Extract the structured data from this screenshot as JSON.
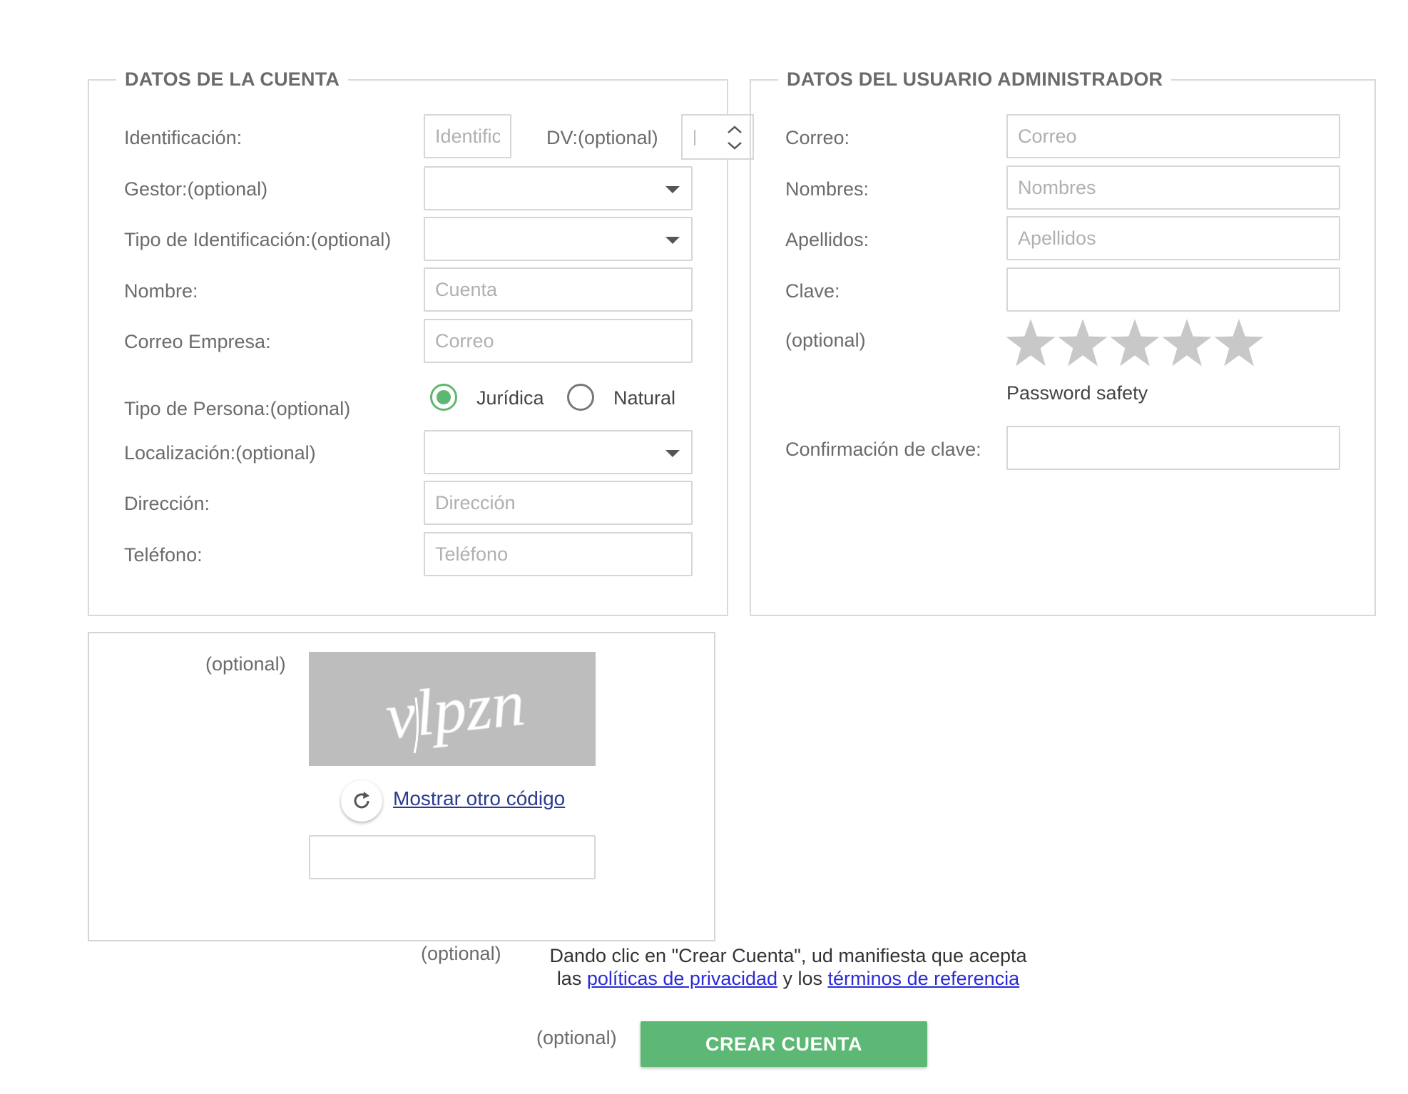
{
  "account": {
    "legend": "DATOS DE LA CUENTA",
    "identificacion": {
      "label": "Identificación:",
      "placeholder": "Identificación"
    },
    "dv": {
      "label": "DV:(optional)",
      "value": ""
    },
    "gestor": {
      "label": "Gestor:(optional)",
      "value": ""
    },
    "tipo_identificacion": {
      "label": "Tipo de Identificación:(optional)",
      "value": ""
    },
    "nombre": {
      "label": "Nombre:",
      "placeholder": "Cuenta"
    },
    "correo_empresa": {
      "label": "Correo Empresa:",
      "placeholder": "Correo"
    },
    "tipo_persona": {
      "label": "Tipo de Persona:(optional)",
      "options": [
        "Jurídica",
        "Natural"
      ],
      "selected": "Jurídica"
    },
    "localizacion": {
      "label": "Localización:(optional)",
      "value": ""
    },
    "direccion": {
      "label": "Dirección:",
      "placeholder": "Dirección"
    },
    "telefono": {
      "label": "Teléfono:",
      "placeholder": "Teléfono"
    }
  },
  "admin": {
    "legend": "DATOS DEL USUARIO ADMINISTRADOR",
    "correo": {
      "label": "Correo:",
      "placeholder": "Correo"
    },
    "nombres": {
      "label": "Nombres:",
      "placeholder": "Nombres"
    },
    "apellidos": {
      "label": "Apellidos:",
      "placeholder": "Apellidos"
    },
    "clave": {
      "label": "Clave:",
      "value": ""
    },
    "strength": {
      "label": "(optional)",
      "caption": "Password safety",
      "rating": 0,
      "max": 5
    },
    "confirmacion": {
      "label": "Confirmación de clave:",
      "value": ""
    }
  },
  "captcha": {
    "label": "(optional)",
    "image_text": "vlpzn",
    "refresh_link": "Mostrar otro código",
    "input_value": ""
  },
  "terms": {
    "label": "(optional)",
    "line1": "Dando clic en \"Crear Cuenta\", ud manifiesta que acepta",
    "line2_prefix": "las ",
    "privacy_link": "políticas de privacidad",
    "line2_mid": " y los ",
    "terms_link": "términos de referencia"
  },
  "submit": {
    "label": "(optional)",
    "button": "CREAR CUENTA"
  },
  "colors": {
    "accent_green": "#5cb874",
    "radio_green": "#5cb870",
    "link_blue": "#2b2bd6",
    "border": "#d6d6d6",
    "star_gray": "#c8c8c8"
  }
}
